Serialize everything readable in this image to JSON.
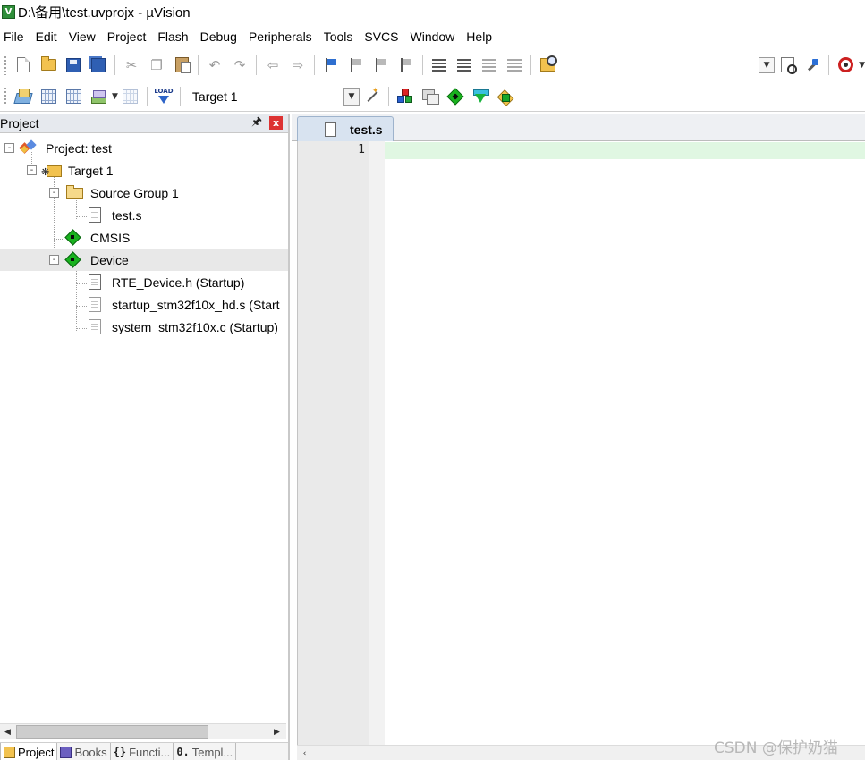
{
  "window": {
    "title": "D:\\备用\\test.uvprojx - µVision",
    "app_icon_glyph": "V"
  },
  "menu": [
    "File",
    "Edit",
    "View",
    "Project",
    "Flash",
    "Debug",
    "Peripherals",
    "Tools",
    "SVCS",
    "Window",
    "Help"
  ],
  "toolbar2": {
    "target": "Target 1",
    "load_icon_text": "LOAD"
  },
  "project_panel": {
    "title": "Project",
    "pin_glyph": "🖈",
    "close_glyph": "x",
    "tree": [
      {
        "label": "Project: test",
        "icon": "project-icon",
        "expander": "-"
      },
      {
        "label": "Target 1",
        "icon": "target-icon",
        "expander": "-"
      },
      {
        "label": "Source Group 1",
        "icon": "folder-open-icon",
        "expander": "-"
      },
      {
        "label": "test.s",
        "icon": "asm-file-icon"
      },
      {
        "label": "CMSIS",
        "icon": "rte-component-icon"
      },
      {
        "label": "Device",
        "icon": "rte-component-icon",
        "expander": "-"
      },
      {
        "label": "RTE_Device.h (Startup)",
        "icon": "header-file-icon"
      },
      {
        "label": "startup_stm32f10x_hd.s (Start",
        "icon": "asm-file-icon"
      },
      {
        "label": "system_stm32f10x.c (Startup)",
        "icon": "c-file-icon"
      }
    ],
    "tabs": [
      {
        "label": "Project",
        "icon": "project-tab-icon",
        "active": true
      },
      {
        "label": "Books",
        "icon": "books-icon",
        "active": false
      },
      {
        "label": "Functi...",
        "icon": "functions-icon",
        "glyph": "{}",
        "active": false
      },
      {
        "label": "Templ...",
        "icon": "templates-icon",
        "glyph": "0.",
        "active": false
      }
    ]
  },
  "editor": {
    "tab_label": "test.s",
    "line_numbers": [
      "1"
    ],
    "lines": [
      ""
    ]
  },
  "watermark": "CSDN @保护奶猫",
  "colors": {
    "current_line": "#e0f7e2",
    "panel_header": "#e6e9ee",
    "close_button": "#dd3333"
  }
}
